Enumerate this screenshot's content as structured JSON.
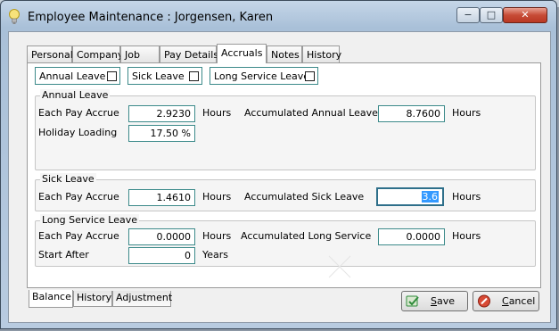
{
  "window": {
    "title": "Employee Maintenance : Jorgensen, Karen",
    "minimize_glyph": "−",
    "maximize_glyph": "□",
    "close_glyph": "✕"
  },
  "tabs": [
    "Personal",
    "Company",
    "Job",
    "Pay Details",
    "Accruals",
    "Notes",
    "History"
  ],
  "active_tab": "Accruals",
  "checkboxes": [
    {
      "label": "Annual Leave",
      "checked": false
    },
    {
      "label": "Sick Leave",
      "checked": false
    },
    {
      "label": "Long Service Leave",
      "checked": false
    }
  ],
  "annual_leave": {
    "title": "Annual Leave",
    "each_pay_accrue_label": "Each Pay Accrue",
    "each_pay_accrue_value": "2.9230",
    "hours_label": "Hours",
    "accumulated_label": "Accumulated Annual Leave",
    "accumulated_value": "8.7600",
    "accumulated_hours_label": "Hours",
    "holiday_loading_label": "Holiday Loading",
    "holiday_loading_value": "17.50 %"
  },
  "sick_leave": {
    "title": "Sick Leave",
    "each_pay_accrue_label": "Each Pay Accrue",
    "each_pay_accrue_value": "1.4610",
    "hours_label": "Hours",
    "accumulated_label": "Accumulated Sick Leave",
    "accumulated_value": "3.6",
    "accumulated_hours_label": "Hours"
  },
  "long_service_leave": {
    "title": "Long Service Leave",
    "each_pay_accrue_label": "Each Pay Accrue",
    "each_pay_accrue_value": "0.0000",
    "hours_label": "Hours",
    "accumulated_label": "Accumulated Long Service",
    "accumulated_value": "0.0000",
    "accumulated_hours_label": "Hours",
    "start_after_label": "Start After",
    "start_after_value": "0",
    "years_label": "Years"
  },
  "bottom_tabs": [
    "Balance",
    "History",
    "Adjustment"
  ],
  "active_bottom_tab": "Balance",
  "buttons": {
    "save": "Save",
    "cancel": "Cancel"
  },
  "colors": {
    "field_border": "#3c8a8a",
    "selection": "#3399ff",
    "save_icon": "#2e8b3a",
    "cancel_icon": "#c0392b"
  }
}
